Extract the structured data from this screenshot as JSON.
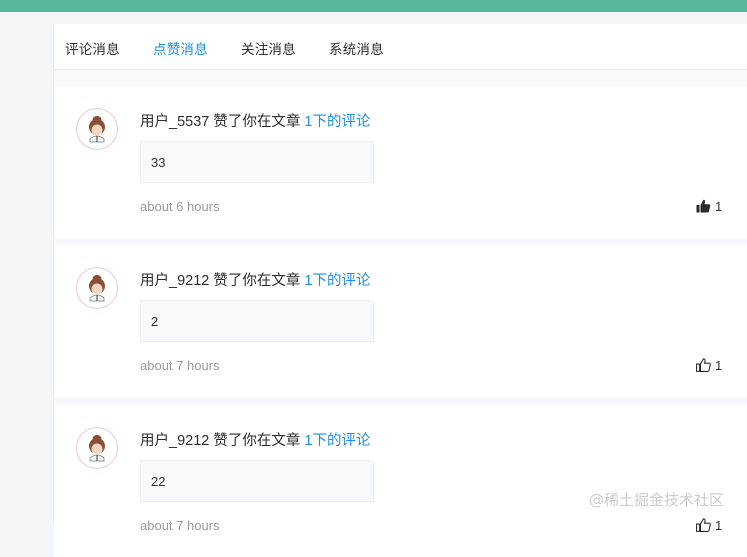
{
  "colors": {
    "accent": "#1e8ee0",
    "topbar": "#58b79a",
    "muted": "#999999"
  },
  "tabs": [
    {
      "label": "评论消息",
      "active": false
    },
    {
      "label": "点赞消息",
      "active": true
    },
    {
      "label": "关注消息",
      "active": false
    },
    {
      "label": "系统消息",
      "active": false
    }
  ],
  "notifications": [
    {
      "user": "用户_5537",
      "action": " 赞了你在文章 ",
      "link": "1下的评论",
      "comment": "33",
      "time": "about 6 hours",
      "likes": "1",
      "liked": true
    },
    {
      "user": "用户_9212",
      "action": " 赞了你在文章 ",
      "link": "1下的评论",
      "comment": "2",
      "time": "about 7 hours",
      "likes": "1",
      "liked": false
    },
    {
      "user": "用户_9212",
      "action": " 赞了你在文章 ",
      "link": "1下的评论",
      "comment": "22",
      "time": "about 7 hours",
      "likes": "1",
      "liked": false
    }
  ],
  "watermark": "@稀土掘金技术社区"
}
